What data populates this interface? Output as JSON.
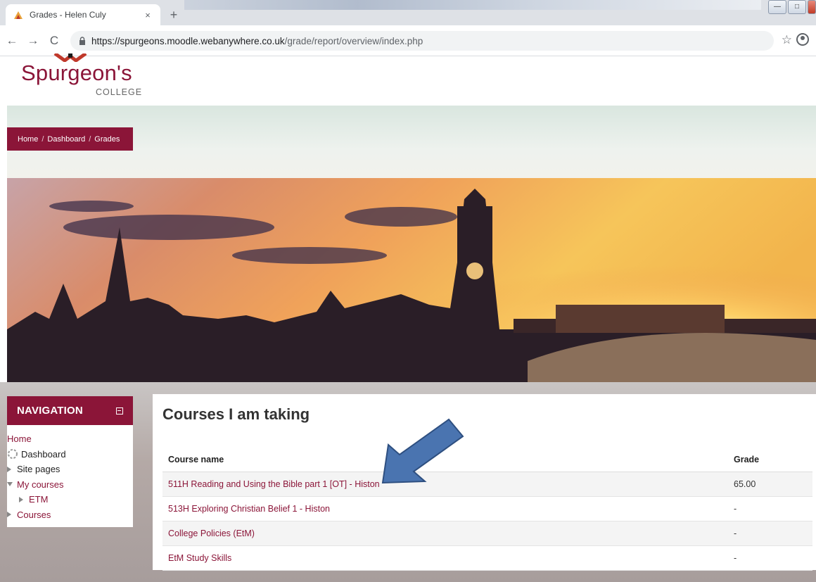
{
  "browser": {
    "tab_title": "Grades - Helen Culy",
    "tab_close": "×",
    "new_tab": "+",
    "url_host": "https://spurgeons.moodle.webanywhere.co.uk",
    "url_path": "/grade/report/overview/index.php",
    "back": "←",
    "forward": "→",
    "reload": "C",
    "star": "☆",
    "win_min": "—",
    "win_max": "□"
  },
  "logo": {
    "name": "Spurgeon's",
    "sub": "COLLEGE"
  },
  "breadcrumb": {
    "items": [
      "Home",
      "Dashboard",
      "Grades"
    ],
    "sep": "/"
  },
  "navigation": {
    "title": "NAVIGATION",
    "items": [
      "Home",
      "Dashboard",
      "Site pages",
      "My courses",
      "ETM",
      "Courses"
    ]
  },
  "main": {
    "title": "Courses I am taking",
    "headers": [
      "Course name",
      "Grade"
    ],
    "rows": [
      {
        "course": "511H Reading and Using the Bible part 1 [OT] - Histon",
        "grade": "65.00"
      },
      {
        "course": "513H Exploring Christian Belief 1 - Histon",
        "grade": "-"
      },
      {
        "course": "College Policies (EtM)",
        "grade": "-"
      },
      {
        "course": "EtM Study Skills",
        "grade": "-"
      }
    ]
  },
  "colors": {
    "brand": "#8b1538",
    "arrow": "#4a74b0"
  }
}
